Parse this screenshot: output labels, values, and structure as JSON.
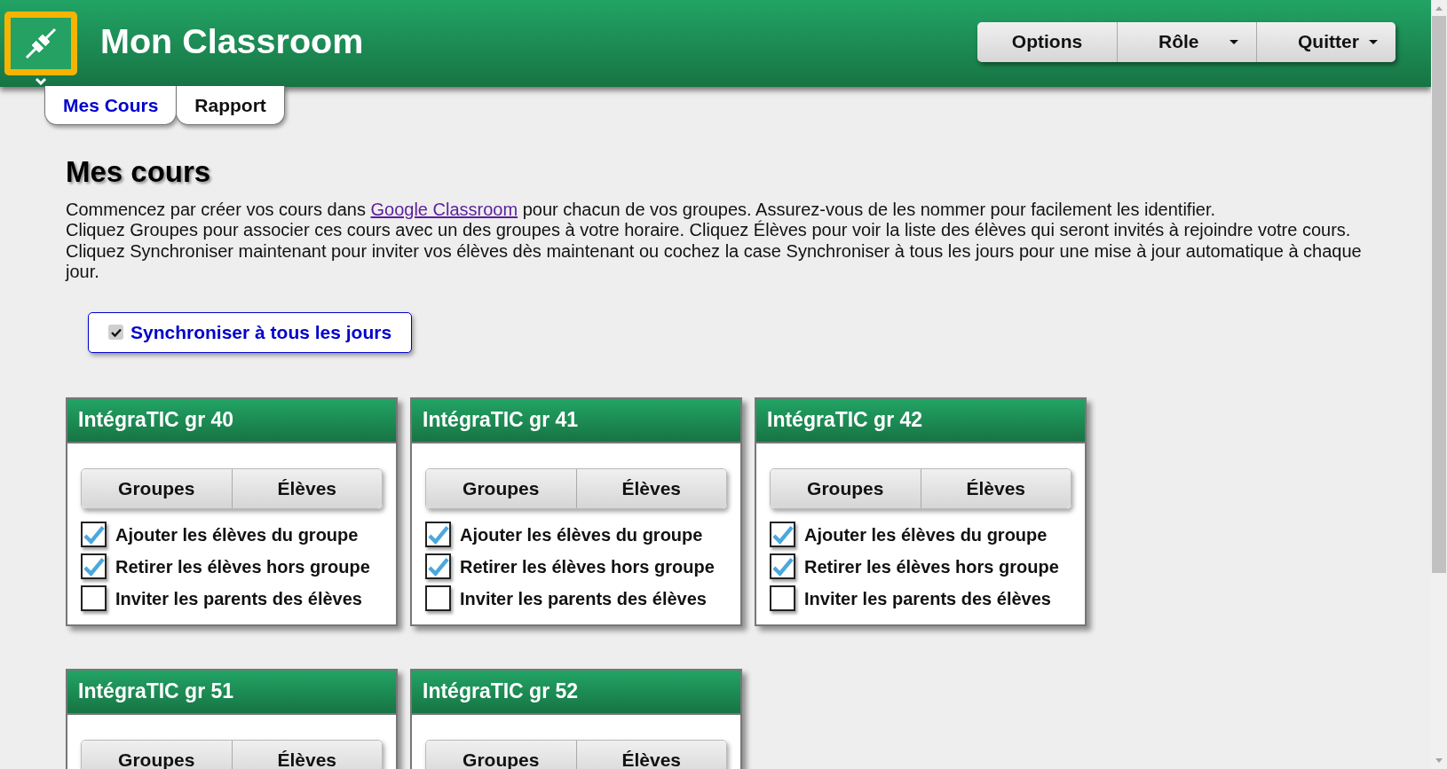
{
  "app": {
    "title": "Mon Classroom"
  },
  "header_buttons": [
    {
      "label": "Options",
      "dropdown": false
    },
    {
      "label": "Rôle",
      "dropdown": true
    },
    {
      "label": "Quitter",
      "dropdown": true
    }
  ],
  "tabs": [
    {
      "label": "Mes Cours",
      "selected": true
    },
    {
      "label": "Rapport",
      "selected": false
    }
  ],
  "page": {
    "heading": "Mes cours",
    "intro": {
      "before": "Commencez par créer vos cours dans ",
      "link": "Google Classroom",
      "after": " pour chacun de vos groupes. Assurez-vous de les nommer pour facilement les identifier."
    },
    "paragraphs": [
      "Cliquez Groupes pour associer ces cours avec un des groupes à votre horaire. Cliquez Élèves pour voir la liste des élèves qui seront invités à rejoindre votre cours.",
      "Cliquez Synchroniser maintenant pour inviter vos élèves dès maintenant ou cochez la case Synchroniser à tous les jours pour une mise à jour automatique à chaque jour."
    ],
    "sync_toggle": {
      "label": "Synchroniser à tous les jours",
      "checked": true
    }
  },
  "courses": [
    {
      "title": "IntégraTIC gr 40",
      "buttons": [
        "Groupes",
        "Élèves"
      ],
      "options": [
        {
          "label": "Ajouter les élèves du groupe",
          "checked": true
        },
        {
          "label": "Retirer les élèves hors groupe",
          "checked": true
        },
        {
          "label": "Inviter les parents des élèves",
          "checked": false
        }
      ]
    },
    {
      "title": "IntégraTIC gr 41",
      "buttons": [
        "Groupes",
        "Élèves"
      ],
      "options": [
        {
          "label": "Ajouter les élèves du groupe",
          "checked": true
        },
        {
          "label": "Retirer les élèves hors groupe",
          "checked": true
        },
        {
          "label": "Inviter les parents des élèves",
          "checked": false
        }
      ]
    },
    {
      "title": "IntégraTIC gr 42",
      "buttons": [
        "Groupes",
        "Élèves"
      ],
      "options": [
        {
          "label": "Ajouter les élèves du groupe",
          "checked": true
        },
        {
          "label": "Retirer les élèves hors groupe",
          "checked": true
        },
        {
          "label": "Inviter les parents des élèves",
          "checked": false
        }
      ]
    },
    {
      "title": "IntégraTIC gr 51",
      "buttons": [
        "Groupes",
        "Élèves"
      ]
    },
    {
      "title": "IntégraTIC gr 52",
      "buttons": [
        "Groupes",
        "Élèves"
      ]
    }
  ]
}
